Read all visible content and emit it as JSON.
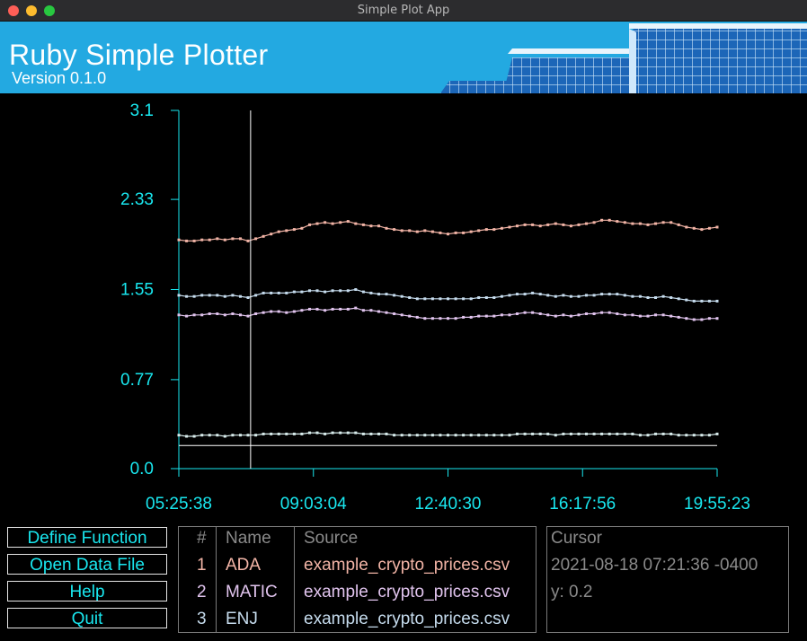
{
  "window": {
    "title": "Simple Plot App"
  },
  "header": {
    "title": "Ruby Simple Plotter",
    "version": "Version 0.1.0"
  },
  "colors": {
    "accent": "#19e7ef",
    "ada": "#f2b4a6",
    "matic": "#e1c4ee",
    "enj": "#c6dcee",
    "fourth": "#d8ecec"
  },
  "chart_data": {
    "type": "line",
    "y_ticks": [
      "3.1",
      "2.33",
      "1.55",
      "0.77",
      "0.0"
    ],
    "x_ticks": [
      "05:25:38",
      "09:03:04",
      "12:40:30",
      "16:17:56",
      "19:55:23"
    ],
    "ylim": [
      0,
      3.1
    ],
    "x_range": [
      "05:25:38",
      "19:55:23"
    ],
    "cursor_x": "07:21:36",
    "cursor_y": 0.2,
    "series": [
      {
        "name": "ADA",
        "color": "#f2b4a6",
        "values": [
          1.98,
          1.97,
          1.97,
          1.98,
          1.98,
          1.99,
          1.98,
          1.99,
          1.99,
          1.97,
          1.99,
          2.01,
          2.03,
          2.05,
          2.06,
          2.07,
          2.08,
          2.11,
          2.12,
          2.13,
          2.12,
          2.13,
          2.14,
          2.12,
          2.11,
          2.1,
          2.1,
          2.08,
          2.07,
          2.06,
          2.06,
          2.05,
          2.06,
          2.05,
          2.04,
          2.03,
          2.04,
          2.04,
          2.05,
          2.06,
          2.07,
          2.07,
          2.08,
          2.09,
          2.1,
          2.11,
          2.11,
          2.1,
          2.11,
          2.12,
          2.11,
          2.1,
          2.11,
          2.12,
          2.13,
          2.15,
          2.15,
          2.14,
          2.13,
          2.12,
          2.12,
          2.11,
          2.12,
          2.13,
          2.13,
          2.11,
          2.09,
          2.08,
          2.07,
          2.08,
          2.09
        ]
      },
      {
        "name": "MATIC",
        "color": "#e1c4ee",
        "values": [
          1.33,
          1.32,
          1.33,
          1.33,
          1.34,
          1.34,
          1.33,
          1.34,
          1.33,
          1.32,
          1.34,
          1.35,
          1.36,
          1.36,
          1.35,
          1.36,
          1.37,
          1.38,
          1.38,
          1.37,
          1.38,
          1.38,
          1.38,
          1.39,
          1.37,
          1.37,
          1.36,
          1.35,
          1.34,
          1.33,
          1.32,
          1.31,
          1.3,
          1.3,
          1.3,
          1.3,
          1.3,
          1.31,
          1.31,
          1.32,
          1.32,
          1.32,
          1.33,
          1.33,
          1.34,
          1.35,
          1.35,
          1.34,
          1.33,
          1.32,
          1.33,
          1.32,
          1.33,
          1.34,
          1.34,
          1.35,
          1.35,
          1.34,
          1.33,
          1.33,
          1.32,
          1.32,
          1.33,
          1.33,
          1.32,
          1.31,
          1.3,
          1.29,
          1.29,
          1.3,
          1.3
        ]
      },
      {
        "name": "ENJ",
        "color": "#c6dcee",
        "values": [
          1.5,
          1.49,
          1.49,
          1.5,
          1.5,
          1.5,
          1.49,
          1.5,
          1.49,
          1.48,
          1.5,
          1.52,
          1.52,
          1.52,
          1.52,
          1.53,
          1.53,
          1.54,
          1.54,
          1.53,
          1.54,
          1.54,
          1.54,
          1.55,
          1.53,
          1.52,
          1.51,
          1.51,
          1.5,
          1.49,
          1.48,
          1.47,
          1.47,
          1.47,
          1.47,
          1.47,
          1.47,
          1.47,
          1.47,
          1.48,
          1.48,
          1.48,
          1.49,
          1.5,
          1.51,
          1.51,
          1.52,
          1.51,
          1.5,
          1.49,
          1.5,
          1.49,
          1.49,
          1.5,
          1.5,
          1.51,
          1.51,
          1.51,
          1.5,
          1.49,
          1.49,
          1.48,
          1.48,
          1.49,
          1.48,
          1.47,
          1.46,
          1.45,
          1.45,
          1.45,
          1.45
        ]
      },
      {
        "name": "",
        "color": "#d8ecec",
        "values": [
          0.29,
          0.28,
          0.28,
          0.29,
          0.29,
          0.29,
          0.28,
          0.29,
          0.29,
          0.29,
          0.29,
          0.3,
          0.3,
          0.3,
          0.3,
          0.3,
          0.3,
          0.31,
          0.31,
          0.3,
          0.31,
          0.31,
          0.31,
          0.31,
          0.3,
          0.3,
          0.3,
          0.3,
          0.29,
          0.29,
          0.29,
          0.29,
          0.29,
          0.29,
          0.29,
          0.29,
          0.29,
          0.29,
          0.29,
          0.29,
          0.29,
          0.29,
          0.29,
          0.29,
          0.3,
          0.3,
          0.3,
          0.3,
          0.3,
          0.29,
          0.3,
          0.3,
          0.3,
          0.3,
          0.3,
          0.3,
          0.3,
          0.3,
          0.3,
          0.3,
          0.29,
          0.29,
          0.3,
          0.3,
          0.3,
          0.29,
          0.29,
          0.29,
          0.29,
          0.29,
          0.3
        ]
      }
    ]
  },
  "buttons": {
    "define_function": "Define Function",
    "open_data_file": "Open Data File",
    "help": "Help",
    "quit": "Quit"
  },
  "table": {
    "headers": [
      "#",
      "Name",
      "Source"
    ],
    "rows": [
      {
        "num": "1",
        "name": "ADA",
        "source": "example_crypto_prices.csv"
      },
      {
        "num": "2",
        "name": "MATIC",
        "source": "example_crypto_prices.csv"
      },
      {
        "num": "3",
        "name": "ENJ",
        "source": "example_crypto_prices.csv"
      }
    ]
  },
  "cursor_panel": {
    "title": "Cursor",
    "timestamp": "2021-08-18 07:21:36 -0400",
    "y": "y: 0.2"
  }
}
